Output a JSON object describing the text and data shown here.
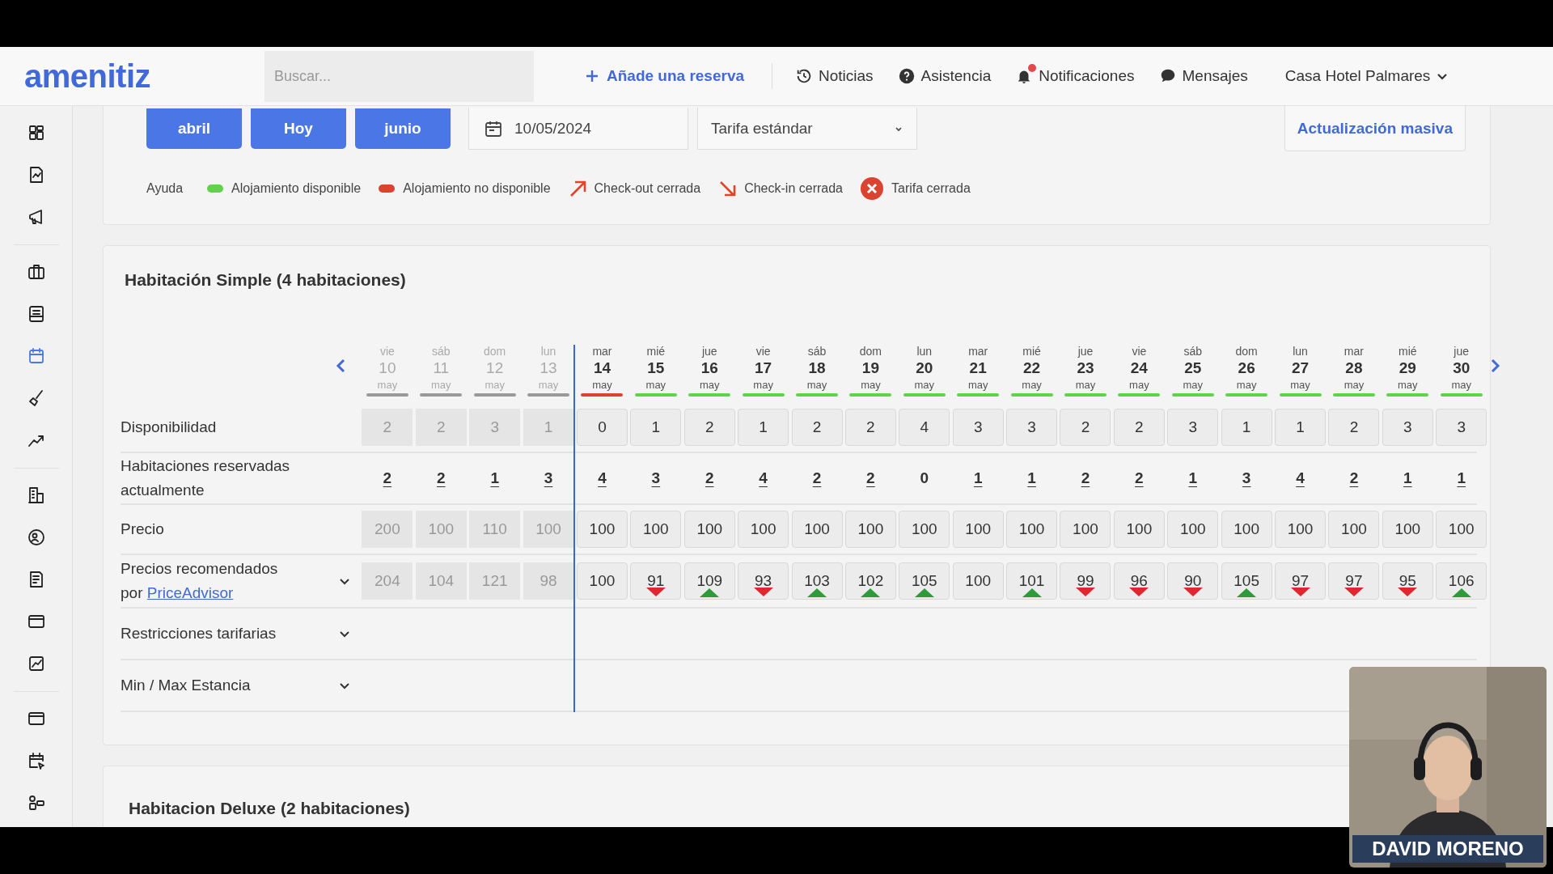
{
  "header": {
    "logo": "amenitiz",
    "search": {
      "placeholder": "Buscar..."
    },
    "add_booking": "Añade una reserva",
    "links": [
      {
        "kind": "news",
        "label": "Noticias"
      },
      {
        "kind": "help",
        "label": "Asistencia"
      },
      {
        "kind": "notifications",
        "label": "Notificaciones",
        "badge": true
      },
      {
        "kind": "messages",
        "label": "Mensajes"
      }
    ],
    "property": "Casa Hotel Palmares"
  },
  "sidebar": {
    "groups": [
      {
        "items": [
          {
            "selected": false
          },
          {
            "selected": false
          },
          {
            "selected": false
          }
        ]
      },
      {
        "items": [
          {
            "selected": false
          },
          {
            "selected": false
          },
          {
            "selected": true
          },
          {
            "selected": false
          },
          {
            "selected": false
          }
        ]
      },
      {
        "items": [
          {
            "selected": false
          },
          {
            "selected": false
          },
          {
            "selected": false
          },
          {
            "selected": false
          },
          {
            "selected": false
          }
        ]
      },
      {
        "items": [
          {
            "selected": false
          },
          {
            "selected": false
          },
          {
            "selected": false
          }
        ]
      }
    ]
  },
  "toolbar": {
    "buttons": [
      "abril",
      "Hoy",
      "junio"
    ],
    "date": "10/05/2024",
    "rate": "Tarifa estándar",
    "bulk_update": "Actualización masiva"
  },
  "legend": {
    "title": "Ayuda",
    "items": [
      {
        "kind": "dot",
        "label": "Alojamiento disponible",
        "color": "#5fd34a"
      },
      {
        "kind": "dot",
        "label": "Alojamiento no disponible",
        "color": "#d9432f"
      },
      {
        "kind": "arrow-up",
        "label": "Check-out cerrada",
        "color": "#e0452a"
      },
      {
        "kind": "arrow-down",
        "label": "Check-in cerrada",
        "color": "#e0452a"
      },
      {
        "kind": "closed",
        "label": "Tarifa cerrada",
        "color": "#d9432f"
      }
    ]
  },
  "rooms": [
    {
      "title": "Habitación Simple (4 habitaciones)",
      "row_labels": {
        "availability": "Disponibilidad",
        "booked": "Habitaciones reservadas actualmente",
        "price": "Precio",
        "recommended": "Precios recomendados",
        "recommended_by": "por",
        "advisor_link": "PriceAdvisor",
        "restrictions": "Restricciones tarifarias",
        "stay": "Min / Max Estancia"
      },
      "days": [
        {
          "weekday": "vie",
          "day": "10",
          "month": "may",
          "past": true,
          "availability": "2",
          "booked": "2",
          "booked_link": true,
          "price": "200",
          "recommended": "204",
          "rising": false,
          "falling": false
        },
        {
          "weekday": "sáb",
          "day": "11",
          "month": "may",
          "past": true,
          "availability": "2",
          "booked": "2",
          "booked_link": true,
          "price": "100",
          "recommended": "104",
          "rising": false,
          "falling": false
        },
        {
          "weekday": "dom",
          "day": "12",
          "month": "may",
          "past": true,
          "availability": "3",
          "booked": "1",
          "booked_link": true,
          "price": "110",
          "recommended": "121",
          "rising": false,
          "falling": false
        },
        {
          "weekday": "lun",
          "day": "13",
          "month": "may",
          "past": true,
          "availability": "1",
          "booked": "3",
          "booked_link": true,
          "price": "100",
          "recommended": "98",
          "rising": false,
          "falling": false
        },
        {
          "weekday": "mar",
          "day": "14",
          "month": "may",
          "past": false,
          "available": false,
          "availability": "0",
          "booked": "4",
          "booked_link": true,
          "price": "100",
          "recommended": "100",
          "rising": false,
          "falling": false
        },
        {
          "weekday": "mié",
          "day": "15",
          "month": "may",
          "past": false,
          "available": true,
          "availability": "1",
          "booked": "3",
          "booked_link": true,
          "price": "100",
          "recommended": "91",
          "rising": false,
          "falling": true
        },
        {
          "weekday": "jue",
          "day": "16",
          "month": "may",
          "past": false,
          "available": true,
          "availability": "2",
          "booked": "2",
          "booked_link": true,
          "price": "100",
          "recommended": "109",
          "rising": true,
          "falling": false
        },
        {
          "weekday": "vie",
          "day": "17",
          "month": "may",
          "past": false,
          "available": true,
          "availability": "1",
          "booked": "4",
          "booked_link": true,
          "price": "100",
          "recommended": "93",
          "rising": false,
          "falling": true
        },
        {
          "weekday": "sáb",
          "day": "18",
          "month": "may",
          "past": false,
          "available": true,
          "availability": "2",
          "booked": "2",
          "booked_link": true,
          "price": "100",
          "recommended": "103",
          "rising": true,
          "falling": false
        },
        {
          "weekday": "dom",
          "day": "19",
          "month": "may",
          "past": false,
          "available": true,
          "availability": "2",
          "booked": "2",
          "booked_link": true,
          "price": "100",
          "recommended": "102",
          "rising": true,
          "falling": false
        },
        {
          "weekday": "lun",
          "day": "20",
          "month": "may",
          "past": false,
          "available": true,
          "availability": "4",
          "booked": "0",
          "booked_link": false,
          "price": "100",
          "recommended": "105",
          "rising": true,
          "falling": false
        },
        {
          "weekday": "mar",
          "day": "21",
          "month": "may",
          "past": false,
          "available": true,
          "availability": "3",
          "booked": "1",
          "booked_link": true,
          "price": "100",
          "recommended": "100",
          "rising": false,
          "falling": false
        },
        {
          "weekday": "mié",
          "day": "22",
          "month": "may",
          "past": false,
          "available": true,
          "availability": "3",
          "booked": "1",
          "booked_link": true,
          "price": "100",
          "recommended": "101",
          "rising": true,
          "falling": false
        },
        {
          "weekday": "jue",
          "day": "23",
          "month": "may",
          "past": false,
          "available": true,
          "availability": "2",
          "booked": "2",
          "booked_link": true,
          "price": "100",
          "recommended": "99",
          "rising": false,
          "falling": true
        },
        {
          "weekday": "vie",
          "day": "24",
          "month": "may",
          "past": false,
          "available": true,
          "availability": "2",
          "booked": "2",
          "booked_link": true,
          "price": "100",
          "recommended": "96",
          "rising": false,
          "falling": true
        },
        {
          "weekday": "sáb",
          "day": "25",
          "month": "may",
          "past": false,
          "available": true,
          "availability": "3",
          "booked": "1",
          "booked_link": true,
          "price": "100",
          "recommended": "90",
          "rising": false,
          "falling": true
        },
        {
          "weekday": "dom",
          "day": "26",
          "month": "may",
          "past": false,
          "available": true,
          "availability": "1",
          "booked": "3",
          "booked_link": true,
          "price": "100",
          "recommended": "105",
          "rising": true,
          "falling": false
        },
        {
          "weekday": "lun",
          "day": "27",
          "month": "may",
          "past": false,
          "available": true,
          "availability": "1",
          "booked": "4",
          "booked_link": true,
          "price": "100",
          "recommended": "97",
          "rising": false,
          "falling": true
        },
        {
          "weekday": "mar",
          "day": "28",
          "month": "may",
          "past": false,
          "available": true,
          "availability": "2",
          "booked": "2",
          "booked_link": true,
          "price": "100",
          "recommended": "97",
          "rising": false,
          "falling": true
        },
        {
          "weekday": "mié",
          "day": "29",
          "month": "may",
          "past": false,
          "available": true,
          "availability": "3",
          "booked": "1",
          "booked_link": true,
          "price": "100",
          "recommended": "95",
          "rising": false,
          "falling": true
        },
        {
          "weekday": "jue",
          "day": "30",
          "month": "may",
          "past": false,
          "available": true,
          "availability": "3",
          "booked": "1",
          "booked_link": true,
          "price": "100",
          "recommended": "106",
          "rising": true,
          "falling": false
        }
      ]
    },
    {
      "title": "Habitacion Deluxe (2 habitaciones)"
    }
  ],
  "webcam": {
    "caption": "DAVID MORENO"
  }
}
